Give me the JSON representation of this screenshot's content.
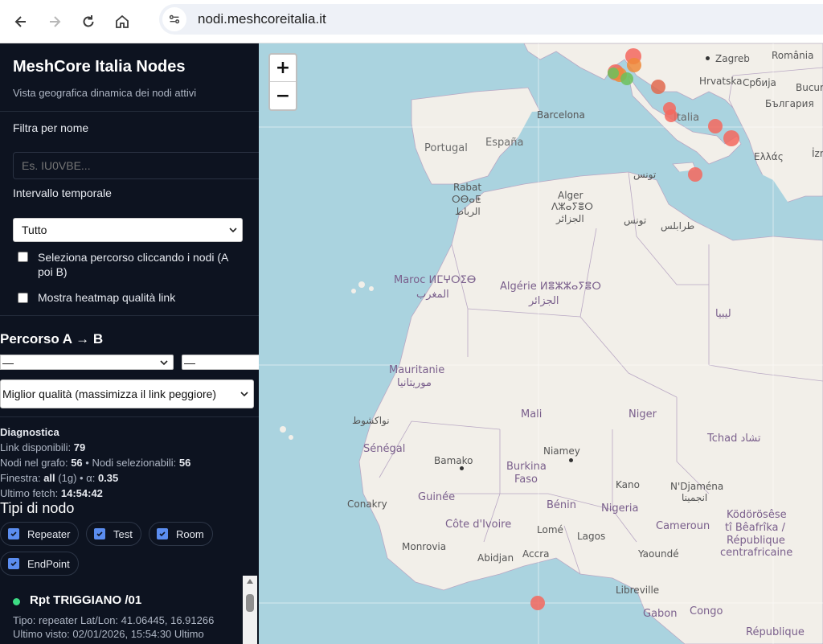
{
  "browser": {
    "url": "nodi.meshcoreitalia.it"
  },
  "sidebar": {
    "title": "MeshCore Italia Nodes",
    "subtitle": "Vista geografica dinamica dei nodi attivi",
    "filter_label": "Filtra per nome",
    "filter_placeholder": "Es. IU0VBE...",
    "interval_label": "Intervallo temporale",
    "interval_value": "Tutto",
    "path_select_label": "Seleziona percorso cliccando i nodi (A poi B)",
    "heatmap_label": "Mostra heatmap qualità link",
    "path_heading": "Percorso A → B",
    "path_a_value": "—",
    "path_b_value": "—",
    "path_mode_value": "Miglior qualità (massimizza il link peggiore)",
    "diagnostics": {
      "heading": "Diagnostica",
      "links_label": "Link disponibili:",
      "links_value": "79",
      "nodes_graph_label": "Nodi nel grafo:",
      "nodes_graph_value": "56",
      "nodes_selectable_label": "• Nodi selezionabili:",
      "nodes_selectable_value": "56",
      "window_label": "Finestra:",
      "window_value": "all",
      "window_extra": "(1g) • α:",
      "alpha_value": "0.35",
      "last_fetch_label": "Ultimo fetch:",
      "last_fetch_value": "14:54:42"
    },
    "node_types_heading": "Tipi di nodo",
    "node_types": [
      "Repeater",
      "Test",
      "Room",
      "EndPoint"
    ],
    "node": {
      "name": "Rpt TRIGGIANO /01",
      "line1": "Tipo: repeater Lat/Lon: 41.06445, 16.91266",
      "line2": "Ultimo visto: 02/01/2026, 15:54:30 Ultimo"
    }
  },
  "map": {
    "zoom_in": "+",
    "zoom_out": "−",
    "labels": {
      "zagreb": "Zagreb",
      "romania": "România",
      "hrvatska": "Hrvatska",
      "srbija": "Србија",
      "bucuresti": "Bucure",
      "bulgaria": "България",
      "barcelona": "Barcelona",
      "italia": "Italia",
      "portugal": "Portugal",
      "espana": "España",
      "tunis": "تونس",
      "ellas": "Ελλάς",
      "izmir": "İzr",
      "rabat": "Rabat",
      "rabat_tif": "ⵔⴱⴰⵟ",
      "rabat_ar": "الرباط",
      "alger": "Alger",
      "alger_tif": "ⴷⵣⴰⵢⴻⵔ",
      "alger_ar": "الجزائر",
      "tunisia_ar": "تونس",
      "tripoli_ar": "طرابلس",
      "maroc": "Maroc ⵍⵎⵖⵔⵉⴱ",
      "maroc_ar": "المغرب",
      "algerie": "Algérie ⵍⴻⵣⵣⴰⵢⴻⵔ",
      "algerie_ar": "الجزائر",
      "libya_ar": "ليبيا",
      "mauritanie": "Mauritanie",
      "mauritanie_ar": "موريتانيا",
      "nouakchott_ar": "نواكشوط",
      "mali": "Mali",
      "niger": "Niger",
      "tchad": "Tchad تشاد",
      "senegal": "Sénégal",
      "niamey": "Niamey",
      "bamako": "Bamako",
      "burkina": "Burkina",
      "faso": "Faso",
      "kano": "Kano",
      "ndjamena": "N'Djaména",
      "ndjamena_ar": "انجمينا",
      "conakry": "Conakry",
      "guinee": "Guinée",
      "benin": "Bénin",
      "nigeria": "Nigeria",
      "cote": "Côte d'Ivoire",
      "lome": "Lomé",
      "lagos": "Lagos",
      "cameroun": "Cameroun",
      "kodorosese": "Ködörösêse",
      "bea": "tî Bêafrîka /",
      "republique": "République",
      "centrafricaine": "centrafricaine",
      "monrovia": "Monrovia",
      "abidjan": "Abidjan",
      "accra": "Accra",
      "yaounde": "Yaoundé",
      "libreville": "Libreville",
      "gabon": "Gabon",
      "congo": "Congo",
      "republique2": "République"
    }
  }
}
